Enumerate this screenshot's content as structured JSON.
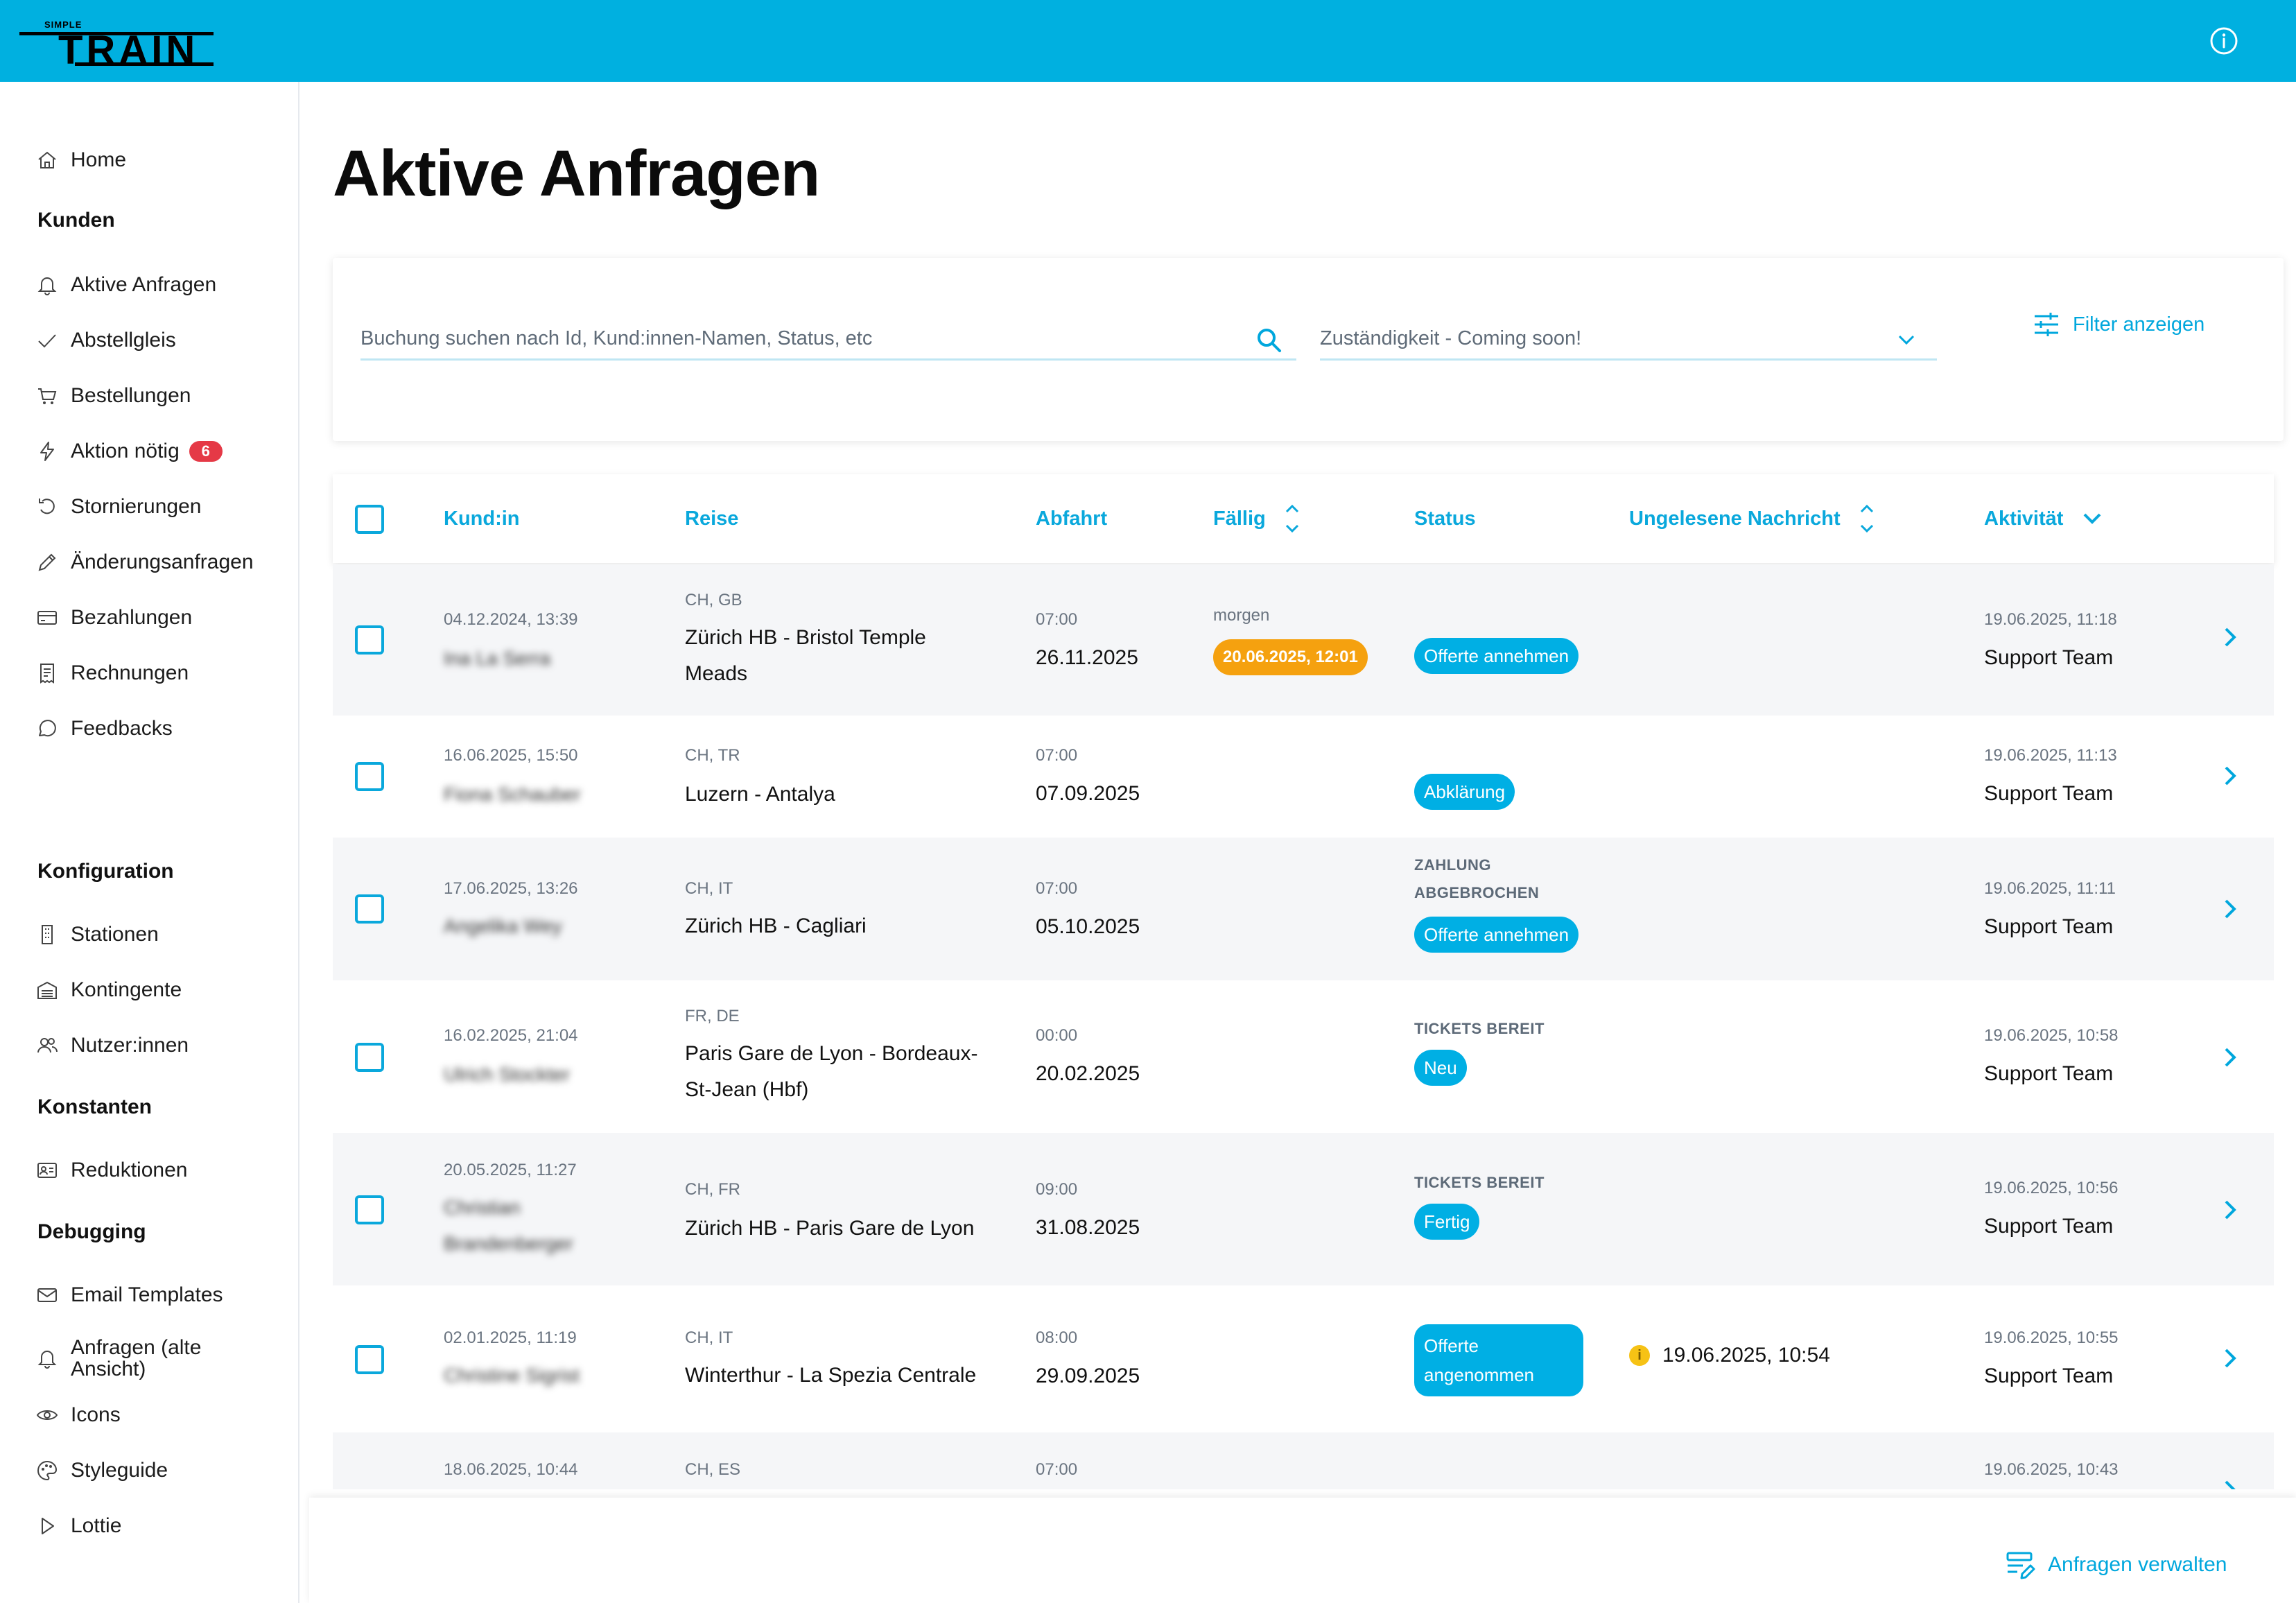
{
  "header": {
    "logo_small": "SIMPLE",
    "logo_big": "TRAIN",
    "accent": "#00b0e0"
  },
  "sidebar": {
    "home": "Home",
    "sections": {
      "kunden": "Kunden",
      "konfiguration": "Konfiguration",
      "konstanten": "Konstanten",
      "debugging": "Debugging"
    },
    "items": {
      "aktive_anfragen": "Aktive Anfragen",
      "abstellgleis": "Abstellgleis",
      "bestellungen": "Bestellungen",
      "aktion_noetig": "Aktion nötig",
      "aktion_badge": "6",
      "stornierungen": "Stornierungen",
      "aenderungsanfragen": "Änderungsanfragen",
      "bezahlungen": "Bezahlungen",
      "rechnungen": "Rechnungen",
      "feedbacks": "Feedbacks",
      "stationen": "Stationen",
      "kontingente": "Kontingente",
      "nutzerinnen": "Nutzer:innen",
      "reduktionen": "Reduktionen",
      "email_templates": "Email Templates",
      "anfragen_alt": "Anfragen (alte Ansicht)",
      "icons": "Icons",
      "styleguide": "Styleguide",
      "lottie": "Lottie"
    }
  },
  "main": {
    "title": "Aktive Anfragen",
    "search_placeholder": "Buchung suchen nach Id, Kund:innen-Namen, Status, etc",
    "select_value": "Zuständigkeit - Coming soon!",
    "filter_label": "Filter anzeigen",
    "manage_label": "Anfragen verwalten"
  },
  "table": {
    "headers": {
      "kunde": "Kund:in",
      "reise": "Reise",
      "abfahrt": "Abfahrt",
      "faellig": "Fällig",
      "status": "Status",
      "nachricht": "Ungelesene Nachricht",
      "aktivitaet": "Aktivität"
    },
    "rows": [
      {
        "created": "04.12.2024, 13:39",
        "customer": "Ina La Serra",
        "countries": "CH, GB",
        "route": "Zürich HB - Bristol Temple Meads",
        "dep_time": "07:00",
        "dep_date": "26.11.2025",
        "due_label": "morgen",
        "due_date": "20.06.2025, 12:01",
        "status_top": "",
        "status": "Offerte annehmen",
        "message": "",
        "activity_time": "19.06.2025, 11:18",
        "activity_by": "Support Team"
      },
      {
        "created": "16.06.2025, 15:50",
        "customer": "Fiona Schauber",
        "countries": "CH, TR",
        "route": "Luzern - Antalya",
        "dep_time": "07:00",
        "dep_date": "07.09.2025",
        "due_label": "",
        "due_date": "",
        "status_top": "",
        "status": "Abklärung",
        "message": "",
        "activity_time": "19.06.2025, 11:13",
        "activity_by": "Support Team"
      },
      {
        "created": "17.06.2025, 13:26",
        "customer": "Angelika Wey",
        "countries": "CH, IT",
        "route": "Zürich HB - Cagliari",
        "dep_time": "07:00",
        "dep_date": "05.10.2025",
        "due_label": "",
        "due_date": "",
        "status_top": "ZAHLUNG ABGEBROCHEN",
        "status": "Offerte annehmen",
        "message": "",
        "activity_time": "19.06.2025, 11:11",
        "activity_by": "Support Team"
      },
      {
        "created": "16.02.2025, 21:04",
        "customer": "Ulrich Stockter",
        "countries": "FR, DE",
        "route": "Paris Gare de Lyon - Bordeaux-St-Jean (Hbf)",
        "dep_time": "00:00",
        "dep_date": "20.02.2025",
        "due_label": "",
        "due_date": "",
        "status_top": "TICKETS BEREIT",
        "status": "Neu",
        "message": "",
        "activity_time": "19.06.2025, 10:58",
        "activity_by": "Support Team"
      },
      {
        "created": "20.05.2025, 11:27",
        "customer": "Christian Brandenberger",
        "countries": "CH, FR",
        "route": "Zürich HB - Paris Gare de Lyon",
        "dep_time": "09:00",
        "dep_date": "31.08.2025",
        "due_label": "",
        "due_date": "",
        "status_top": "TICKETS BEREIT",
        "status": "Fertig",
        "message": "",
        "activity_time": "19.06.2025, 10:56",
        "activity_by": "Support Team"
      },
      {
        "created": "02.01.2025, 11:19",
        "customer": "Christine Sigrist",
        "countries": "CH, IT",
        "route": "Winterthur - La Spezia Centrale",
        "dep_time": "08:00",
        "dep_date": "29.09.2025",
        "due_label": "",
        "due_date": "",
        "status_top": "",
        "status": "Offerte angenommen",
        "message": "19.06.2025, 10:54",
        "message_icon": "i",
        "activity_time": "19.06.2025, 10:55",
        "activity_by": "Support Team"
      },
      {
        "created": "18.06.2025, 10:44",
        "countries": "CH, ES",
        "dep_time": "07:00",
        "activity_time": "19.06.2025, 10:43"
      }
    ]
  }
}
